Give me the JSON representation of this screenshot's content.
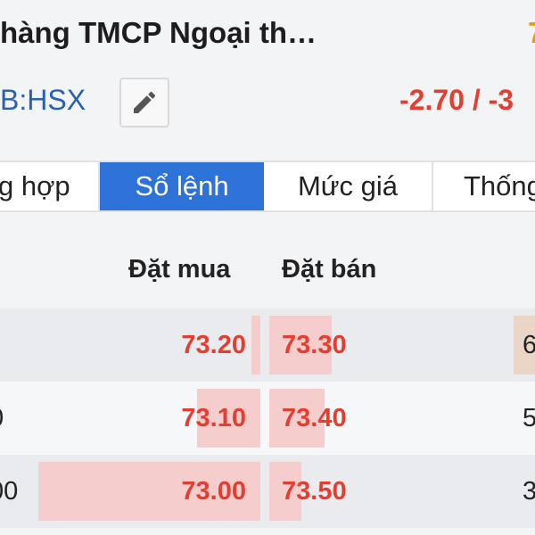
{
  "header": {
    "title": "hàng TMCP Ngoại th…",
    "title_right_partial": "7",
    "ticker": "B:HSX",
    "change": "-2.70 / -3"
  },
  "tabs": [
    {
      "label": "g hợp",
      "active": false
    },
    {
      "label": "Sổ lệnh",
      "active": true
    },
    {
      "label": "Mức giá",
      "active": false
    },
    {
      "label": "Thống",
      "active": false
    }
  ],
  "orderbook": {
    "bid_header": "Đặt mua",
    "ask_header": "Đặt bán",
    "rows": [
      {
        "bid_volume": "",
        "bid_price": "73.20",
        "ask_price": "73.30",
        "ask_volume": "6",
        "bid_bar": 0.04,
        "ask_bar": 0.22
      },
      {
        "bid_volume": "0",
        "bid_price": "73.10",
        "ask_price": "73.40",
        "ask_volume": "5",
        "bid_bar": 0.28,
        "ask_bar": 0.19
      },
      {
        "bid_volume": "00",
        "bid_price": "73.00",
        "ask_price": "73.50",
        "ask_volume": "3",
        "bid_bar": 1.0,
        "ask_bar": 0.15
      }
    ]
  },
  "colors": {
    "accent": "#2d72d6",
    "down": "#e53e30",
    "ticker": "#2a5fb3",
    "bar": "#f5cdcd",
    "volume_bar": "#ead6c6"
  }
}
